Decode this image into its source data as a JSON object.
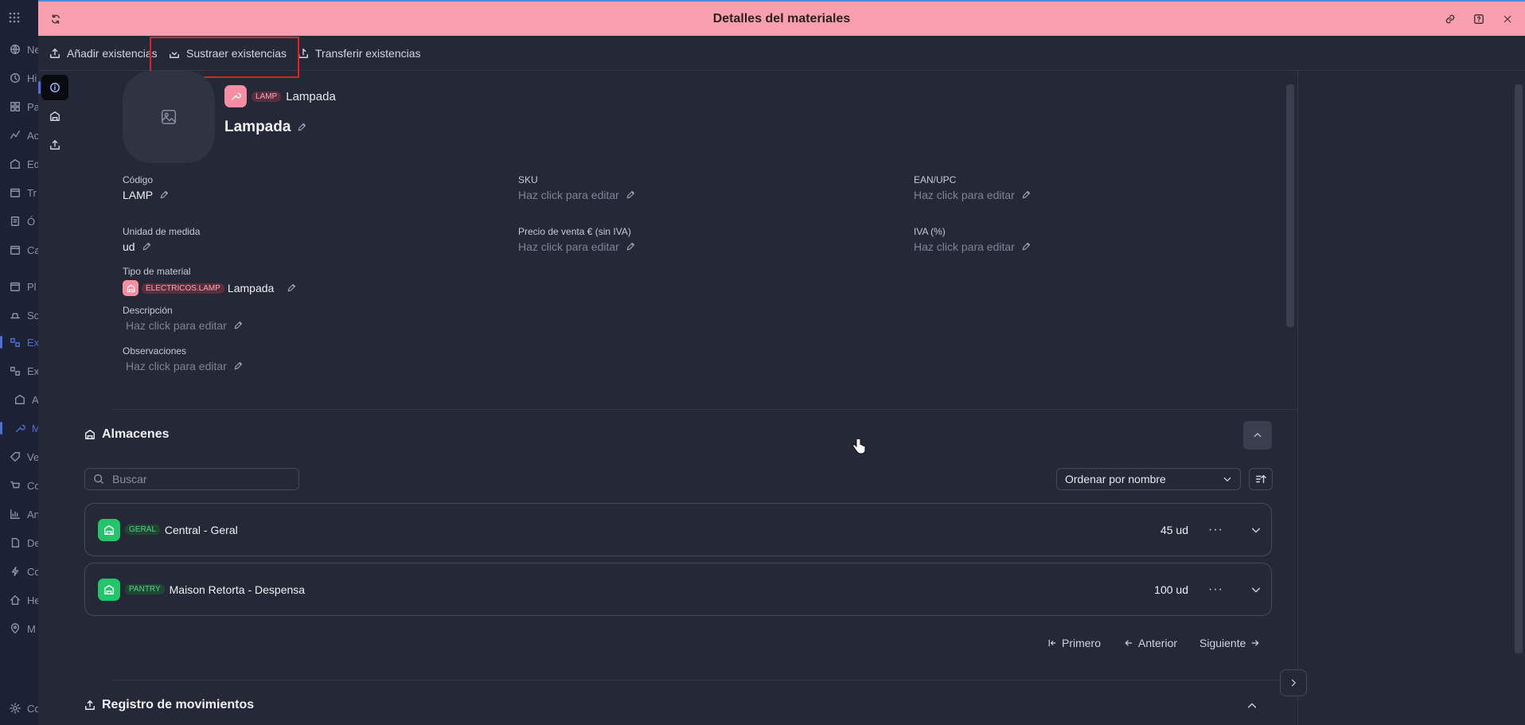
{
  "colors": {
    "header_bg": "#f9a0b0",
    "accent": "#4f6fd6",
    "highlight": "#e0202a",
    "material_pink": "#f58ea2",
    "warehouse_green": "#22c56a"
  },
  "background_sidebar": {
    "items": [
      {
        "label": "Ne",
        "icon": "globe-icon"
      },
      {
        "label": "Hi",
        "icon": "history-icon"
      },
      {
        "label": "Pa",
        "icon": "grid-icon"
      },
      {
        "label": "Ac",
        "icon": "activity-icon"
      },
      {
        "label": "Ed",
        "icon": "building-icon"
      },
      {
        "label": "Tr",
        "icon": "calendar-icon"
      },
      {
        "label": "Ó",
        "icon": "clipboard-icon"
      },
      {
        "label": "Ca",
        "icon": "calendar-icon"
      },
      {
        "label": "Pl",
        "icon": "calendar-icon"
      },
      {
        "label": "So",
        "icon": "tray-icon"
      },
      {
        "label": "Ex",
        "icon": "inventory-icon"
      },
      {
        "label": "Ex",
        "icon": "inventory-icon"
      },
      {
        "label": "A",
        "icon": "warehouse-icon"
      },
      {
        "label": "M",
        "icon": "wrench-icon"
      },
      {
        "label": "Ve",
        "icon": "tag-icon"
      },
      {
        "label": "Co",
        "icon": "cart-icon"
      },
      {
        "label": "An",
        "icon": "chart-icon"
      },
      {
        "label": "De",
        "icon": "document-icon"
      },
      {
        "label": "Co",
        "icon": "bolt-icon"
      },
      {
        "label": "He",
        "icon": "home-icon"
      },
      {
        "label": "M",
        "icon": "map-pin-icon"
      },
      {
        "label": "Co",
        "icon": "gear-icon"
      }
    ]
  },
  "header": {
    "title": "Detalles del materiales"
  },
  "toolbar": {
    "add_stock": "Añadir existencias",
    "subtract_stock": "Sustraer existencias",
    "transfer_stock": "Transferir existencias"
  },
  "material": {
    "code_tag": "LAMP",
    "type_name": "Lampada",
    "title": "Lampada",
    "fields": {
      "code": {
        "label": "Código",
        "value": "LAMP"
      },
      "sku": {
        "label": "SKU",
        "value": "Haz click para editar"
      },
      "ean": {
        "label": "EAN/UPC",
        "value": "Haz click para editar"
      },
      "unit": {
        "label": "Unidad de medida",
        "value": "ud"
      },
      "price": {
        "label": "Precio de venta € (sin IVA)",
        "value": "Haz click para editar"
      },
      "vat": {
        "label": "IVA (%)",
        "value": "Haz click para editar"
      },
      "type": {
        "label": "Tipo de material",
        "tag": "ELECTRICOS.LAMP",
        "value": "Lampada"
      },
      "description": {
        "label": "Descripción",
        "value": "Haz click para editar"
      },
      "observations": {
        "label": "Observaciones",
        "value": "Haz click para editar"
      }
    }
  },
  "warehouses": {
    "title": "Almacenes",
    "search_placeholder": "Buscar",
    "sort_label": "Ordenar por nombre",
    "items": [
      {
        "tag": "GERAL",
        "name": "Central - Geral",
        "quantity": "45 ud"
      },
      {
        "tag": "PANTRY",
        "name": "Maison Retorta - Despensa",
        "quantity": "100 ud"
      }
    ],
    "pagination": {
      "first": "Primero",
      "previous": "Anterior",
      "next": "Siguiente"
    }
  },
  "movements": {
    "title": "Registro de movimientos"
  }
}
